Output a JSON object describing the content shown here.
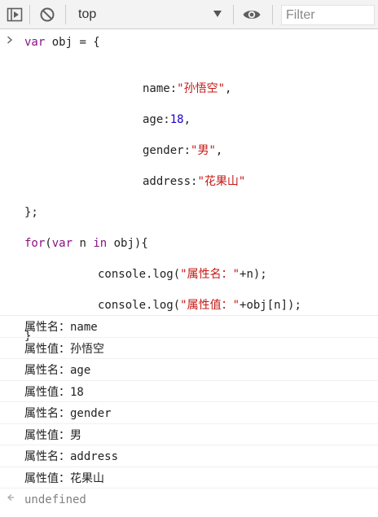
{
  "toolbar": {
    "context": "top",
    "filter_placeholder": "Filter"
  },
  "input": {
    "lines": [
      {
        "parts": [
          {
            "t": "var",
            "c": "kw2"
          },
          {
            "t": " obj = {",
            "c": "blk"
          }
        ]
      },
      {
        "parts": [
          {
            "t": "name:",
            "c": "blk"
          },
          {
            "t": "\"孙悟空\"",
            "c": "str"
          },
          {
            "t": ",",
            "c": "blk"
          }
        ]
      },
      {
        "parts": [
          {
            "t": "age:",
            "c": "blk"
          },
          {
            "t": "18",
            "c": "num"
          },
          {
            "t": ",",
            "c": "blk"
          }
        ]
      },
      {
        "parts": [
          {
            "t": "gender:",
            "c": "blk"
          },
          {
            "t": "\"男\"",
            "c": "str"
          },
          {
            "t": ",",
            "c": "blk"
          }
        ]
      },
      {
        "parts": [
          {
            "t": "address:",
            "c": "blk"
          },
          {
            "t": "\"花果山\"",
            "c": "str"
          }
        ]
      },
      {
        "parts": [
          {
            "t": "};",
            "c": "blk"
          }
        ]
      },
      {
        "parts": [
          {
            "t": "for",
            "c": "kw2"
          },
          {
            "t": "(",
            "c": "blk"
          },
          {
            "t": "var",
            "c": "kw2"
          },
          {
            "t": " n ",
            "c": "blk"
          },
          {
            "t": "in",
            "c": "kw2"
          },
          {
            "t": " obj){",
            "c": "blk"
          }
        ]
      },
      {
        "parts": [
          {
            "t": "console.log(",
            "c": "blk"
          },
          {
            "t": "\"属性名：\"",
            "c": "str"
          },
          {
            "t": "+n);",
            "c": "blk"
          }
        ]
      },
      {
        "parts": [
          {
            "t": "console.log(",
            "c": "blk"
          },
          {
            "t": "\"属性值：\"",
            "c": "str"
          },
          {
            "t": "+obj[n]);",
            "c": "blk"
          }
        ]
      },
      {
        "parts": [
          {
            "t": "}",
            "c": "blk"
          }
        ]
      }
    ]
  },
  "logs": [
    "属性名：name",
    "属性值：孙悟空",
    "属性名：age",
    "属性值：18",
    "属性名：gender",
    "属性值：男",
    "属性名：address",
    "属性值：花果山"
  ],
  "result": "undefined",
  "icons": {
    "sidebar": "sidebar-toggle-icon",
    "clear": "clear-console-icon",
    "eye": "eye-icon",
    "prompt": "chevron-right-icon",
    "result": "return-arrow-icon"
  }
}
